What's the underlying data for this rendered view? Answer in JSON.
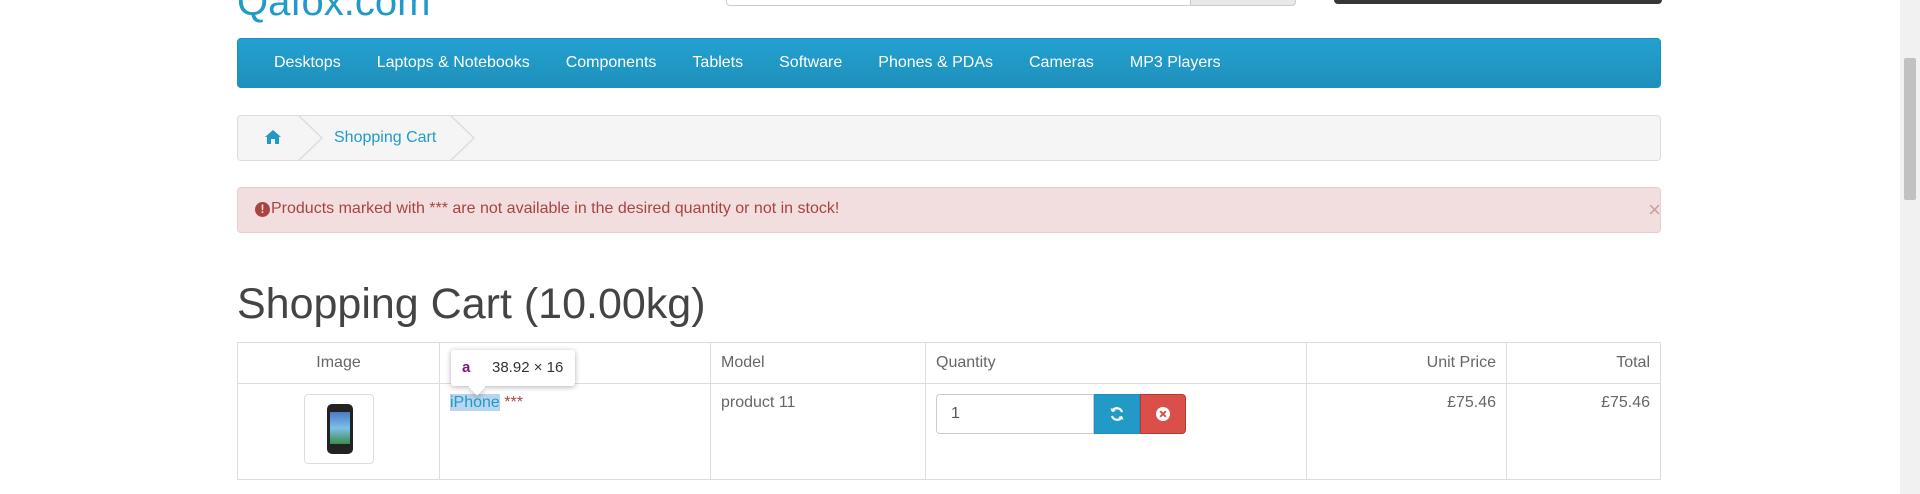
{
  "header": {
    "logo_text": "Qafox.com"
  },
  "nav": {
    "items": [
      "Desktops",
      "Laptops & Notebooks",
      "Components",
      "Tablets",
      "Software",
      "Phones & PDAs",
      "Cameras",
      "MP3 Players"
    ]
  },
  "breadcrumb": {
    "home_icon": "home-icon",
    "current": "Shopping Cart"
  },
  "alert": {
    "icon": "exclamation-circle-icon",
    "message": "Products marked with *** are not available in the desired quantity or not in stock!",
    "close": "×"
  },
  "page": {
    "title": "Shopping Cart  (10.00kg)"
  },
  "cart_table": {
    "headers": {
      "image": "Image",
      "model": "Model",
      "quantity": "Quantity",
      "unit_price": "Unit Price",
      "total": "Total"
    },
    "rows": [
      {
        "product_name": "iPhone",
        "stock_marker": " ***",
        "model": "product 11",
        "quantity": "1",
        "unit_price": "£75.46",
        "total": "£75.46"
      }
    ]
  },
  "inspector_tooltip": {
    "tag": "a",
    "dimensions": "38.92 × 16"
  },
  "colors": {
    "accent": "#229ac8",
    "nav_bg": "#229ac8",
    "alert_bg": "#f2dede",
    "alert_text": "#a94442",
    "remove_btn": "#da4f49"
  }
}
